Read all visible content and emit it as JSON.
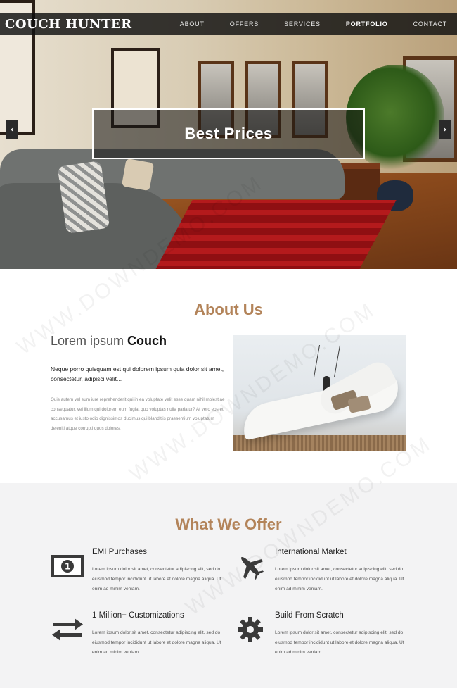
{
  "header": {
    "brand": "COUCH HUNTER",
    "nav": [
      {
        "label": "ABOUT",
        "active": false
      },
      {
        "label": "OFFERS",
        "active": false
      },
      {
        "label": "SERVICES",
        "active": false
      },
      {
        "label": "PORTFOLIO",
        "active": true
      },
      {
        "label": "CONTACT",
        "active": false
      }
    ]
  },
  "hero": {
    "caption": "Best Prices",
    "prev_icon": "chevron-left-icon",
    "next_icon": "chevron-right-icon",
    "prev_glyph": "‹",
    "next_glyph": "›"
  },
  "about": {
    "title": "About Us",
    "heading_light": "Lorem ipsum ",
    "heading_bold": "Couch",
    "lead": "Neque porro quisquam est qui dolorem ipsum quia dolor sit amet, consectetur, adipisci velit...",
    "body": "Quis autem vel eum iure reprehenderit qui in ea voluptate velit esse quam nihil molestiae consequatur, vel illum qui dolorem eum fugiat quo voluptas nulla pariatur? At vero eos et accusamus et iusto odio dignissimos ducimus qui blanditiis praesentium voluptatum deleniti atque corrupti quos dolores."
  },
  "offer": {
    "title": "What We Offer",
    "features": [
      {
        "title": "EMI Purchases",
        "icon": "money-icon",
        "desc": "Lorem ipsum dolor sit amet, consectetur adipiscing elit, sed do eiusmod tempor incididunt ut labore et dolore magna aliqua. Ut enim ad minim veniam."
      },
      {
        "title": "International Market",
        "icon": "plane-icon",
        "desc": "Lorem ipsum dolor sit amet, consectetur adipiscing elit, sed do eiusmod tempor incididunt ut labore et dolore magna aliqua. Ut enim ad minim veniam."
      },
      {
        "title": "1 Million+ Customizations",
        "icon": "exchange-icon",
        "desc": "Lorem ipsum dolor sit amet, consectetur adipiscing elit, sed do eiusmod tempor incididunt ut labore et dolore magna aliqua. Ut enim ad minim veniam."
      },
      {
        "title": "Build From Scratch",
        "icon": "gear-icon",
        "desc": "Lorem ipsum dolor sit amet, consectetur adipiscing elit, sed do eiusmod tempor incididunt ut labore et dolore magna aliqua. Ut enim ad minim veniam."
      }
    ]
  },
  "colors": {
    "accent": "#b3845a",
    "navbar": "#0f0f0f",
    "offer_bg": "#f3f3f4"
  },
  "watermark": "WWW.DOWNDEMO.COM"
}
